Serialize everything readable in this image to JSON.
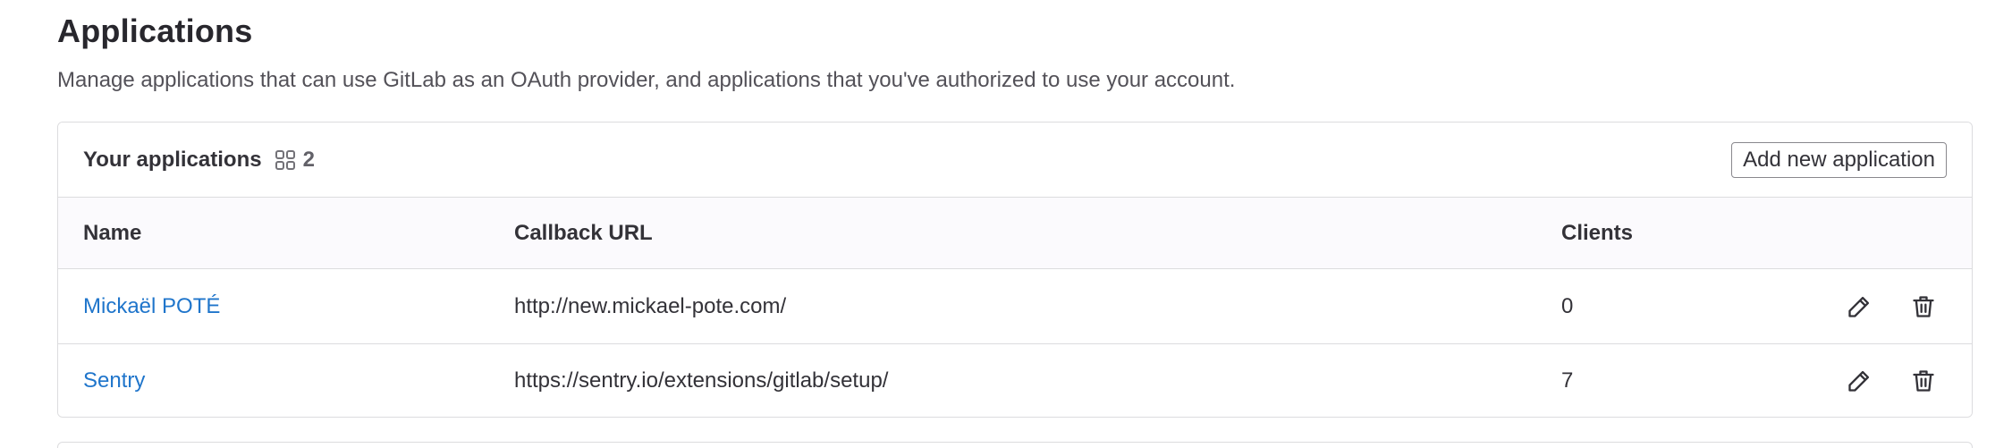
{
  "page": {
    "title": "Applications",
    "description": "Manage applications that can use GitLab as an OAuth provider, and applications that you've authorized to use your account."
  },
  "your_applications": {
    "title": "Your applications",
    "count_icon": "applications-grid-icon",
    "count": "2",
    "add_button_label": "Add new application",
    "columns": {
      "name": "Name",
      "callback_url": "Callback URL",
      "clients": "Clients"
    },
    "rows": [
      {
        "name": "Mickaël POTÉ",
        "callback_url": "http://new.mickael-pote.com/",
        "clients": "0",
        "edit_icon": "pencil-icon",
        "delete_icon": "trash-icon"
      },
      {
        "name": "Sentry",
        "callback_url": "https://sentry.io/extensions/gitlab/setup/",
        "clients": "7",
        "edit_icon": "pencil-icon",
        "delete_icon": "trash-icon"
      }
    ]
  },
  "colors": {
    "link": "#1f75cb",
    "text": "#333238",
    "muted": "#535158",
    "border": "#dcdcde",
    "header_bg": "#fbfafd"
  }
}
